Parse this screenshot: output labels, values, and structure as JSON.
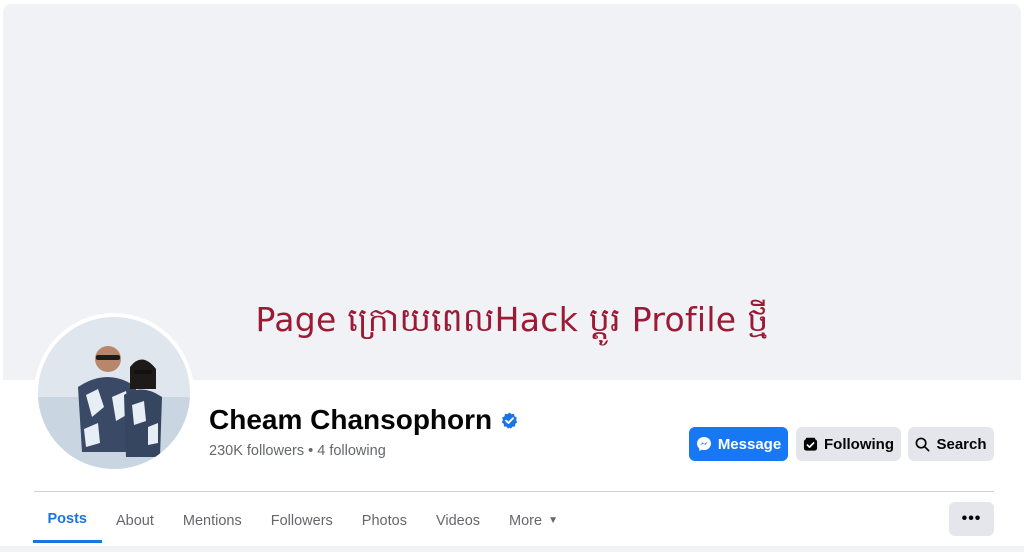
{
  "cover": {
    "caption": "Page ក្រោយពេលHack ប្តូរ Profile ថ្មី"
  },
  "profile": {
    "name": "Cheam Chansophorn",
    "follow_stats": "230K followers • 4 following"
  },
  "actions": {
    "message_label": "Message",
    "following_label": "Following",
    "search_label": "Search"
  },
  "tabs": [
    {
      "label": "Posts",
      "active": true
    },
    {
      "label": "About"
    },
    {
      "label": "Mentions"
    },
    {
      "label": "Followers"
    },
    {
      "label": "Photos"
    },
    {
      "label": "Videos"
    },
    {
      "label": "More"
    }
  ],
  "more_menu_label": "•••",
  "colors": {
    "accent": "#1877f2",
    "caption": "#9c1a35",
    "button_gray": "#e4e6eb"
  }
}
